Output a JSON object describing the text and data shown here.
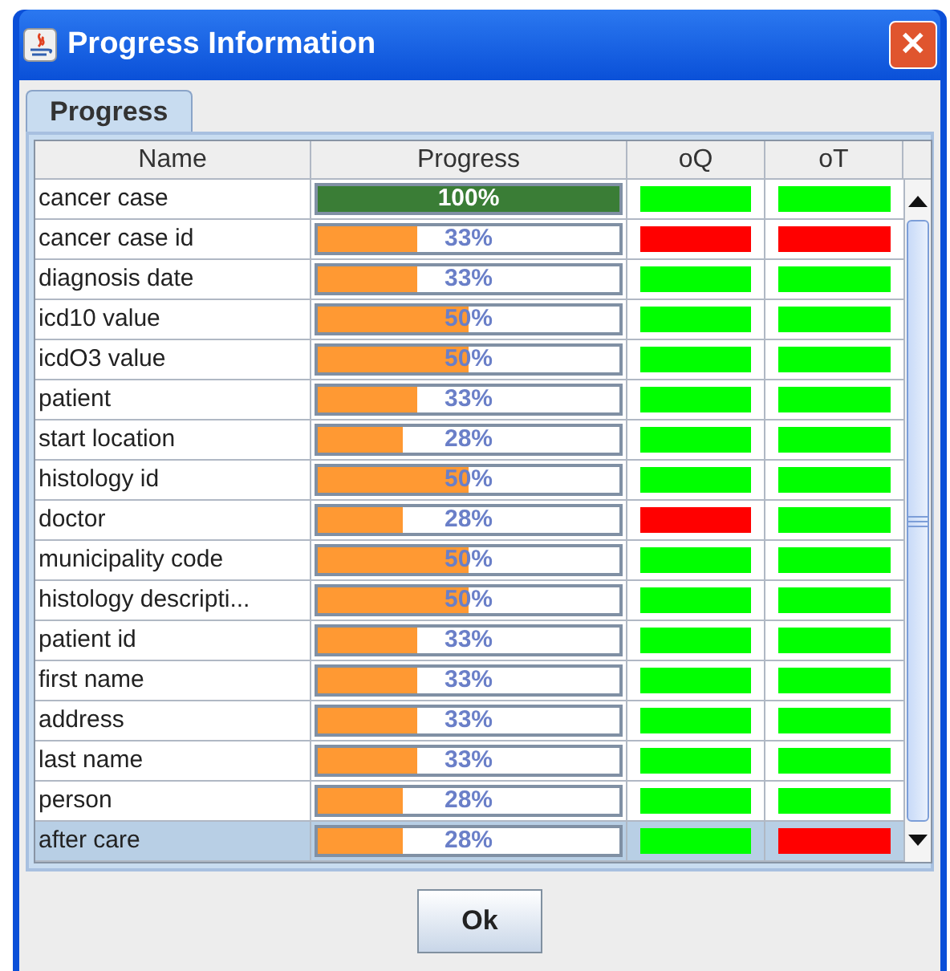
{
  "window": {
    "title": "Progress Information",
    "close": "✕"
  },
  "tabs": [
    {
      "label": "Progress",
      "selected": true
    }
  ],
  "table": {
    "columns": [
      "Name",
      "Progress",
      "oQ",
      "oT"
    ],
    "rows": [
      {
        "name": "cancer case",
        "level": 1,
        "percent": "100%",
        "oq": {
          "color": "#00ff00"
        },
        "ot": {
          "color": "#00ff00"
        },
        "selected": false
      },
      {
        "name": "cancer case id",
        "level": 0.33,
        "percent": "33%",
        "oq": {
          "color": "#ff0000"
        },
        "ot": {
          "color": "#ff0000"
        },
        "selected": false
      },
      {
        "name": "diagnosis date",
        "level": 0.33,
        "percent": "33%",
        "oq": {
          "color": "#00ff00"
        },
        "ot": {
          "color": "#00ff00"
        },
        "selected": false
      },
      {
        "name": "icd10 value",
        "level": 0.5,
        "percent": "50%",
        "oq": {
          "color": "#00ff00"
        },
        "ot": {
          "color": "#00ff00"
        },
        "selected": false
      },
      {
        "name": "icdO3 value",
        "level": 0.5,
        "percent": "50%",
        "oq": {
          "color": "#00ff00"
        },
        "ot": {
          "color": "#00ff00"
        },
        "selected": false
      },
      {
        "name": "patient",
        "level": 0.33,
        "percent": "33%",
        "oq": {
          "color": "#00ff00"
        },
        "ot": {
          "color": "#00ff00"
        },
        "selected": false
      },
      {
        "name": "start location",
        "level": 0.28,
        "percent": "28%",
        "oq": {
          "color": "#00ff00"
        },
        "ot": {
          "color": "#00ff00"
        },
        "selected": false
      },
      {
        "name": "histology id",
        "level": 0.5,
        "percent": "50%",
        "oq": {
          "color": "#00ff00"
        },
        "ot": {
          "color": "#00ff00"
        },
        "selected": false
      },
      {
        "name": "doctor",
        "level": 0.28,
        "percent": "28%",
        "oq": {
          "color": "#ff0000"
        },
        "ot": {
          "color": "#00ff00"
        },
        "selected": false
      },
      {
        "name": "municipality code",
        "level": 0.5,
        "percent": "50%",
        "oq": {
          "color": "#00ff00"
        },
        "ot": {
          "color": "#00ff00"
        },
        "selected": false
      },
      {
        "name": "histology descripti...",
        "level": 0.5,
        "percent": "50%",
        "oq": {
          "color": "#00ff00"
        },
        "ot": {
          "color": "#00ff00"
        },
        "selected": false
      },
      {
        "name": "patient id",
        "level": 0.33,
        "percent": "33%",
        "oq": {
          "color": "#00ff00"
        },
        "ot": {
          "color": "#00ff00"
        },
        "selected": false
      },
      {
        "name": "first name",
        "level": 0.33,
        "percent": "33%",
        "oq": {
          "color": "#00ff00"
        },
        "ot": {
          "color": "#00ff00"
        },
        "selected": false
      },
      {
        "name": "address",
        "level": 0.33,
        "percent": "33%",
        "oq": {
          "color": "#00ff00"
        },
        "ot": {
          "color": "#00ff00"
        },
        "selected": false
      },
      {
        "name": "last name",
        "level": 0.33,
        "percent": "33%",
        "oq": {
          "color": "#00ff00"
        },
        "ot": {
          "color": "#00ff00"
        },
        "selected": false
      },
      {
        "name": "person",
        "level": 0.28,
        "percent": "28%",
        "oq": {
          "color": "#00ff00"
        },
        "ot": {
          "color": "#00ff00"
        },
        "selected": false
      },
      {
        "name": "after care",
        "level": 0.28,
        "percent": "28%",
        "oq": {
          "color": "#00ff00"
        },
        "ot": {
          "color": "#ff0000"
        },
        "selected": true
      }
    ]
  },
  "buttons": [
    "Ok"
  ]
}
